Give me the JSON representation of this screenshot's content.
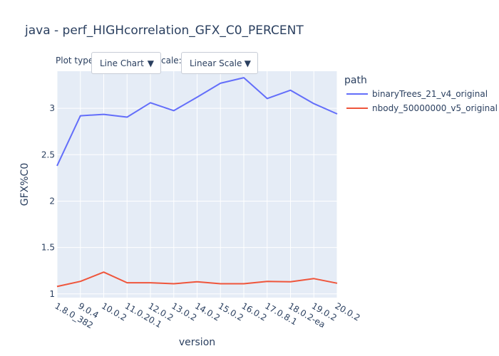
{
  "chart_data": {
    "type": "line",
    "title": "java - perf_HIGHcorrelation_GFX_C0_PERCENT",
    "xlabel": "version",
    "ylabel": "GFX%C0",
    "categories": [
      "1.8.0_382",
      "9.0.4",
      "10.0.2",
      "11.0.20.1",
      "12.0.2",
      "13.0.2",
      "14.0.2",
      "15.0.2",
      "16.0.2",
      "17.0.8.1",
      "18.0.2-ea",
      "19.0.2",
      "20.0.2"
    ],
    "y_ticks": [
      1,
      1.5,
      2,
      2.5,
      3
    ],
    "y_tick_labels": [
      "1",
      "1.5",
      "2",
      "2.5",
      "3"
    ],
    "ylim": [
      0.96,
      3.4
    ],
    "grid": true,
    "legend_title": "path",
    "legend_position": "top-right",
    "series": [
      {
        "name": "binaryTrees_21_v4_original",
        "color": "#636efa",
        "values": [
          2.38,
          2.92,
          2.935,
          2.905,
          3.06,
          2.975,
          3.12,
          3.27,
          3.33,
          3.105,
          3.195,
          3.05,
          2.94
        ]
      },
      {
        "name": "nbody_50000000_v5_original",
        "color": "#ef553b",
        "values": [
          1.08,
          1.135,
          1.235,
          1.12,
          1.12,
          1.11,
          1.13,
          1.11,
          1.11,
          1.135,
          1.13,
          1.165,
          1.115
        ]
      }
    ]
  },
  "controls": {
    "plot_type_label": "Plot type",
    "plot_type_value": "Line Chart",
    "scale_label": "cale:",
    "scale_value": "Linear Scale",
    "arrow": "▼"
  }
}
